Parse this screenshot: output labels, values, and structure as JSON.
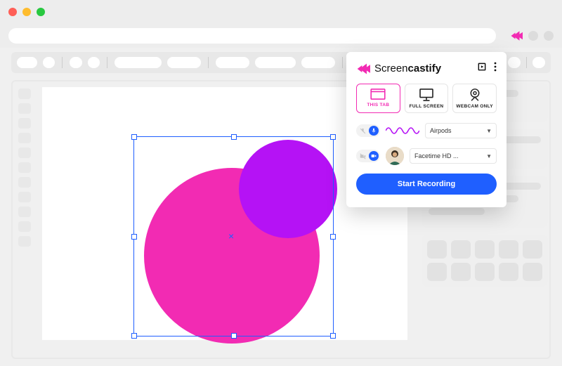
{
  "brand": {
    "name_light": "Screen",
    "name_bold": "castify",
    "logo_color": "#F22BB3",
    "accent": "#1f5fff"
  },
  "popup": {
    "library_tooltip": "Library",
    "menu_tooltip": "More",
    "modes": [
      {
        "id": "this-tab",
        "label": "THIS TAB",
        "active": true
      },
      {
        "id": "full-screen",
        "label": "FULL SCREEN",
        "active": false
      },
      {
        "id": "webcam-only",
        "label": "WEBCAM ONLY",
        "active": false
      }
    ],
    "audio": {
      "enabled": true,
      "device": "Airpods"
    },
    "video": {
      "enabled": true,
      "device": "Facetime HD ..."
    },
    "record_button": "Start Recording"
  },
  "canvas": {
    "big_circle_color": "#F22BB3",
    "small_circle_color": "#B512F5",
    "selection_color": "#1f5fff"
  }
}
